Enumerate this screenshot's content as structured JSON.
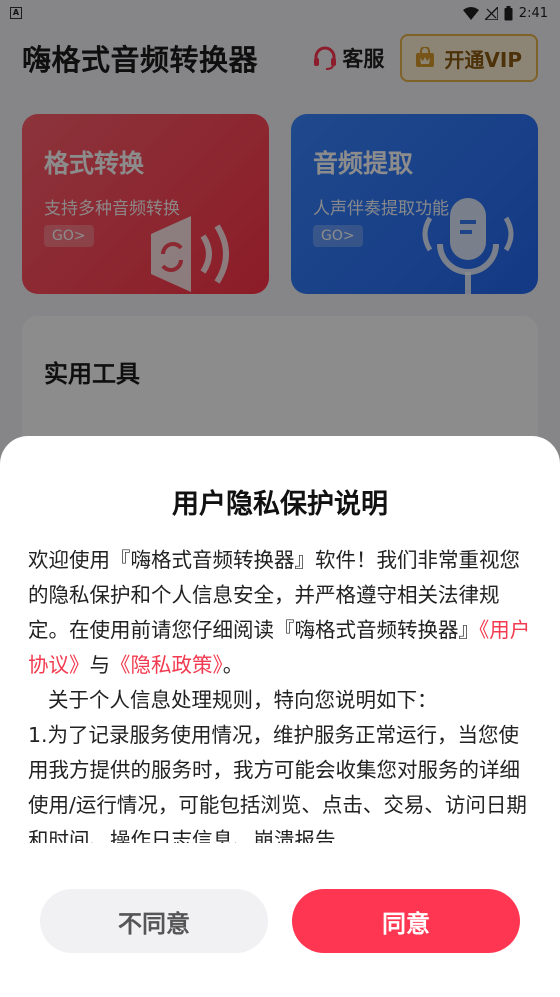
{
  "status_bar": {
    "time": "2:41"
  },
  "header": {
    "title": "嗨格式音频转换器",
    "service_label": "客服",
    "vip_label": "开通VIP"
  },
  "cards": [
    {
      "title": "格式转换",
      "subtitle": "支持多种音频转换",
      "go": "GO>",
      "color": "#ff3448"
    },
    {
      "title": "音频提取",
      "subtitle": "人声伴奏提取功能",
      "go": "GO>",
      "color": "#2468f2"
    }
  ],
  "tools": {
    "title": "实用工具"
  },
  "dialog": {
    "title": "用户隐私保护说明",
    "p1_a": "欢迎使用『嗨格式音频转换器』软件！我们非常重视您的隐私保护和个人信息安全，并严格遵守相关法律规定。在使用前请您仔细阅读『嗨格式音频转换器』",
    "p1_link1": "《用户协议》",
    "p1_and": "与",
    "p1_link2": "《隐私政策》",
    "p1_end": "。",
    "p2": "关于个人信息处理规则，特向您说明如下：",
    "p3": "1.为了记录服务使用情况，维护服务正常运行，当您使用我方提供的服务时，我方可能会收集您对服务的详细使用/运行情况，可能包括浏览、点击、交易、访问日期和时间、操作日志信息、崩溃报告",
    "disagree_label": "不同意",
    "agree_label": "同意",
    "accent": "#ff3652"
  }
}
